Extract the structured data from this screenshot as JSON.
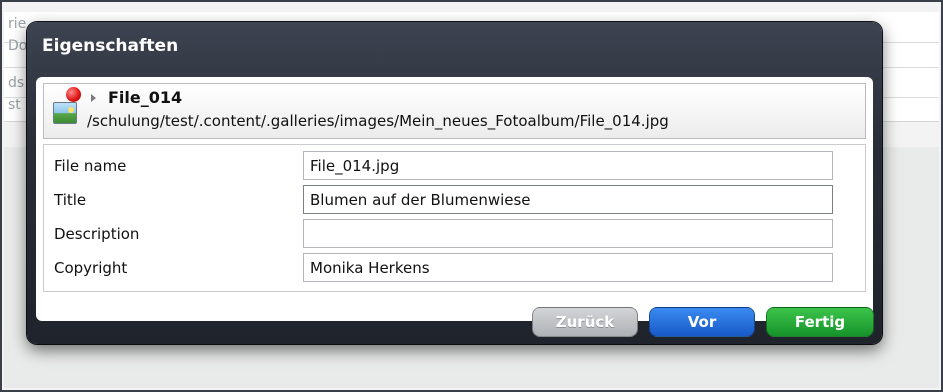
{
  "background": {
    "fragments": [
      "rie",
      "Do",
      "ds",
      "st"
    ]
  },
  "dialog": {
    "title": "Eigenschaften",
    "header": {
      "file_name": "File_014",
      "path": "/schulung/test/.content/.galleries/images/Mein_neues_Fotoalbum/File_014.jpg"
    },
    "fields": [
      {
        "label": "File name",
        "value": "File_014.jpg",
        "focused": false
      },
      {
        "label": "Title",
        "value": "Blumen auf der Blumenwiese",
        "focused": true
      },
      {
        "label": "Description",
        "value": "",
        "focused": false
      },
      {
        "label": "Copyright",
        "value": "Monika Herkens",
        "focused": false
      }
    ],
    "buttons": {
      "back_label": "Zurück",
      "back_enabled": false,
      "next_label": "Vor",
      "done_label": "Fertig"
    },
    "colors": {
      "next_button": "#1f6ad6",
      "done_button": "#22a334",
      "marker_dot": "#e01818"
    },
    "icons": [
      "image-file-icon",
      "red-marker-icon",
      "expand-arrow-icon"
    ]
  }
}
